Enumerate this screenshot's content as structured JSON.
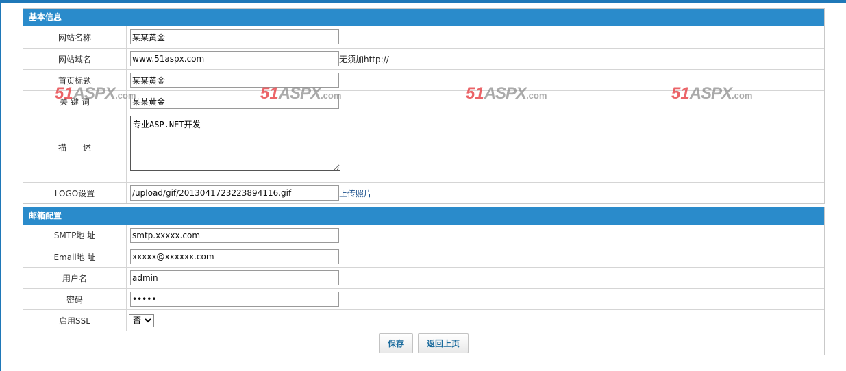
{
  "basic": {
    "header": "基本信息",
    "site_name_label": "网站名称",
    "site_name_value": "某某黄金",
    "domain_label": "网站域名",
    "domain_value": "www.51aspx.com",
    "domain_note": "无须加http://",
    "home_title_label": "首页标题",
    "home_title_value": "某某黄金",
    "keywords_label": "关 键 词",
    "keywords_value": "某某黄金",
    "description_label": "描　　述",
    "description_value": "专业ASP.NET开发",
    "logo_label": "LOGO设置",
    "logo_value": "/upload/gif/20130417232238941‌16.gif",
    "logo_upload_link": "上传照片"
  },
  "mail": {
    "header": "邮箱配置",
    "smtp_label": "SMTP地 址",
    "smtp_value": "smtp.xxxxx.com",
    "email_label": "Email地 址",
    "email_value": "xxxxx@xxxxxx.com",
    "username_label": "用户名",
    "username_value": "admin",
    "password_label": "密码",
    "password_value": "•••••",
    "ssl_label": "启用SSL",
    "ssl_selected": "否"
  },
  "actions": {
    "save_label": "保存",
    "back_label": "返回上页"
  },
  "watermark": {
    "num": "51",
    "aspx": "ASPX",
    "com": ".com"
  },
  "colors": {
    "header_blue": "#2a8bcb",
    "frame_blue": "#1f78b8",
    "watermark_red": "#e8494e"
  }
}
